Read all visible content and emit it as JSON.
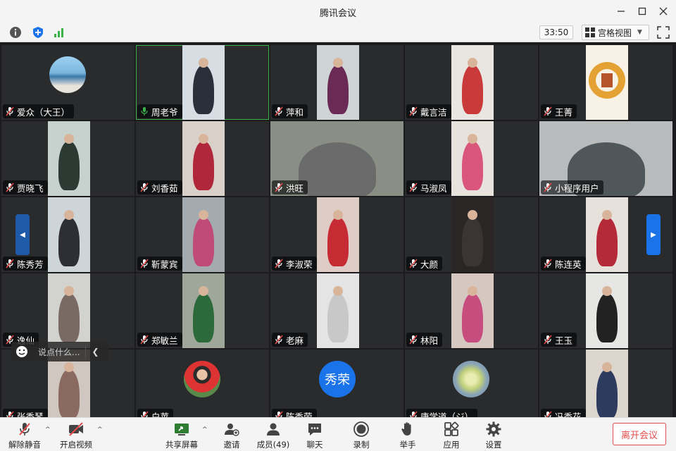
{
  "window": {
    "title": "腾讯会议"
  },
  "infobar": {
    "timer": "33:50",
    "view_label": "宫格视图"
  },
  "participants": [
    {
      "name": "爱众（大王）",
      "mic": "muted"
    },
    {
      "name": "周老爷",
      "mic": "active"
    },
    {
      "name": "萍和",
      "mic": "muted"
    },
    {
      "name": "戴言洁",
      "mic": "muted"
    },
    {
      "name": "王菁",
      "mic": "muted"
    },
    {
      "name": "贾晓飞",
      "mic": "muted"
    },
    {
      "name": "刘香茹",
      "mic": "muted"
    },
    {
      "name": "洪旺",
      "mic": "muted"
    },
    {
      "name": "马淑凤",
      "mic": "muted"
    },
    {
      "name": "小程序用户",
      "mic": "muted"
    },
    {
      "name": "陈秀芳",
      "mic": "muted"
    },
    {
      "name": "靳蒙宾",
      "mic": "muted"
    },
    {
      "name": "李淑荣",
      "mic": "muted"
    },
    {
      "name": "大颜",
      "mic": "muted"
    },
    {
      "name": "陈连英",
      "mic": "muted"
    },
    {
      "name": "逸仙",
      "mic": "muted"
    },
    {
      "name": "郑敏兰",
      "mic": "muted"
    },
    {
      "name": "老麻",
      "mic": "muted"
    },
    {
      "name": "林阳",
      "mic": "muted"
    },
    {
      "name": "王玉",
      "mic": "muted"
    },
    {
      "name": "张秀琴",
      "mic": "muted"
    },
    {
      "name": "白苹",
      "mic": "muted"
    },
    {
      "name": "陈秀荣",
      "mic": "muted",
      "avatar_text": "秀荣"
    },
    {
      "name": "唐学道（ジ）",
      "mic": "muted"
    },
    {
      "name": "冯秀花",
      "mic": "muted"
    }
  ],
  "chat": {
    "placeholder": "说点什么..."
  },
  "toolbar": {
    "unmute": "解除静音",
    "video": "开启视频",
    "share": "共享屏幕",
    "invite": "邀请",
    "members": "成员(49)",
    "chat": "聊天",
    "record": "录制",
    "raise_hand": "举手",
    "apps": "应用",
    "settings": "设置",
    "leave": "离开会议"
  },
  "colors": {
    "accent_blue": "#1a73e8",
    "mic_muted": "#e24b4b",
    "mic_active": "#3db24a",
    "leave_red": "#e34d4d"
  }
}
